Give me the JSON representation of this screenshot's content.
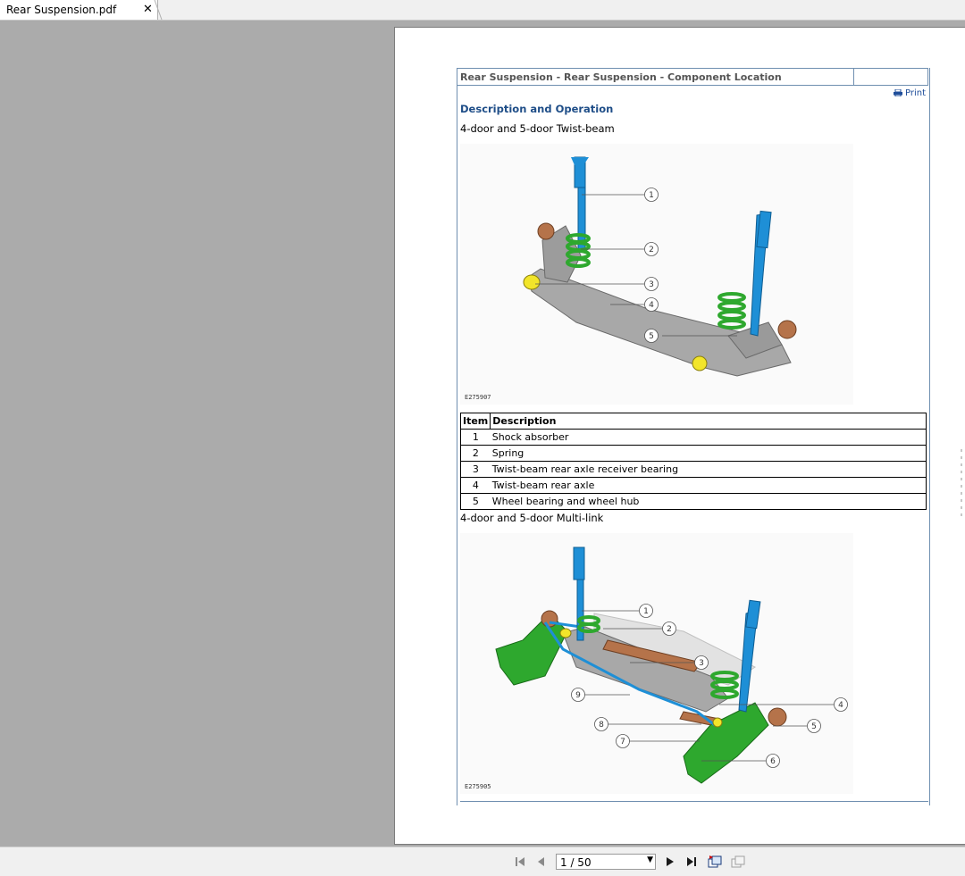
{
  "tab": {
    "title": "Rear Suspension.pdf",
    "close": "✕"
  },
  "document": {
    "header_title": "Rear Suspension - Rear Suspension - Component Location",
    "print_label": "Print",
    "section_title": "Description and Operation",
    "variant1": "4-door and 5-door Twist-beam",
    "figure1_code": "E275907",
    "figure1_callouts": [
      "1",
      "2",
      "3",
      "4",
      "5"
    ],
    "table": {
      "headers": [
        "Item",
        "Description"
      ],
      "rows": [
        {
          "item": "1",
          "description": "Shock absorber"
        },
        {
          "item": "2",
          "description": "Spring"
        },
        {
          "item": "3",
          "description": "Twist-beam rear axle receiver bearing"
        },
        {
          "item": "4",
          "description": "Twist-beam rear axle"
        },
        {
          "item": "5",
          "description": "Wheel bearing and wheel hub"
        }
      ]
    },
    "variant2": "4-door and 5-door Multi-link",
    "figure2_code": "E275905",
    "figure2_callouts": [
      "1",
      "2",
      "3",
      "4",
      "5",
      "6",
      "7",
      "8",
      "9"
    ]
  },
  "navigation": {
    "page_indicator": "1 / 50",
    "first_icon": "first-page-icon",
    "prev_icon": "previous-page-icon",
    "next_icon": "next-page-icon",
    "last_icon": "last-page-icon"
  },
  "colors": {
    "shock": "#1e8fd6",
    "spring": "#2ea82e",
    "axle": "#9e9e9e",
    "bearing": "#f2e52a",
    "hub": "#b5734a",
    "link": "#1f4e88"
  }
}
